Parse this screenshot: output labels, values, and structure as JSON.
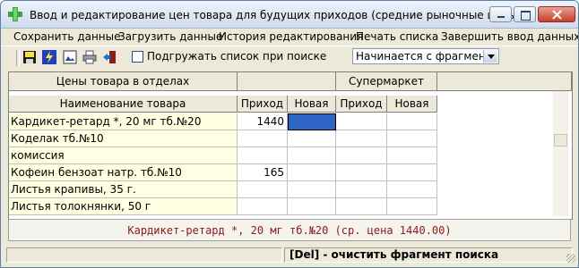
{
  "window": {
    "title": "Ввод и редактирование цен товара для будущих приходов (средние рыночные цены)"
  },
  "menu": [
    "Сохранить данные",
    "Загрузить данные",
    "История редактирования",
    "Печать списка",
    "Завершить ввод данных"
  ],
  "toolbar": {
    "buttons": [
      "save-disk-icon",
      "lightning-icon",
      "image-icon",
      "printer-icon",
      "exit-door-icon"
    ],
    "checkbox_label": "Подгружать список при поиске",
    "checkbox_checked": false,
    "search_mode": "Начинается с фрагмента"
  },
  "grid": {
    "group_headers": [
      "Цены товара в отделах",
      "Супермаркет"
    ],
    "columns": [
      "Наименование товара",
      "Приход",
      "Новая",
      "Приход",
      "Новая"
    ],
    "rows": [
      {
        "name": "Кардикет-ретард *, 20 мг тб.№20",
        "prihod1": "1440",
        "nova1": "",
        "prihod2": "",
        "nova2": ""
      },
      {
        "name": "Коделак тб.№10",
        "prihod1": "",
        "nova1": "",
        "prihod2": "",
        "nova2": ""
      },
      {
        "name": "комиссия",
        "prihod1": "",
        "nova1": "",
        "prihod2": "",
        "nova2": ""
      },
      {
        "name": "Кофеин бензоат натр. тб.№10",
        "prihod1": "165",
        "nova1": "",
        "prihod2": "",
        "nova2": ""
      },
      {
        "name": "Листья крапивы,  35 г.",
        "prihod1": "",
        "nova1": "",
        "prihod2": "",
        "nova2": ""
      },
      {
        "name": "Листья толокнянки, 50 г",
        "prihod1": "",
        "nova1": "",
        "prihod2": "",
        "nova2": ""
      }
    ]
  },
  "info_line": "Кардикет-ретард *, 20 мг тб.№20 (ср. цена 1440.00)",
  "status": {
    "hint": "[Del] - очистить фрагмент поиска"
  },
  "colors": {
    "name_column_bg": "#ffffe1",
    "selected_cell": "#2f66c6",
    "info_text": "#8b1a1a"
  }
}
